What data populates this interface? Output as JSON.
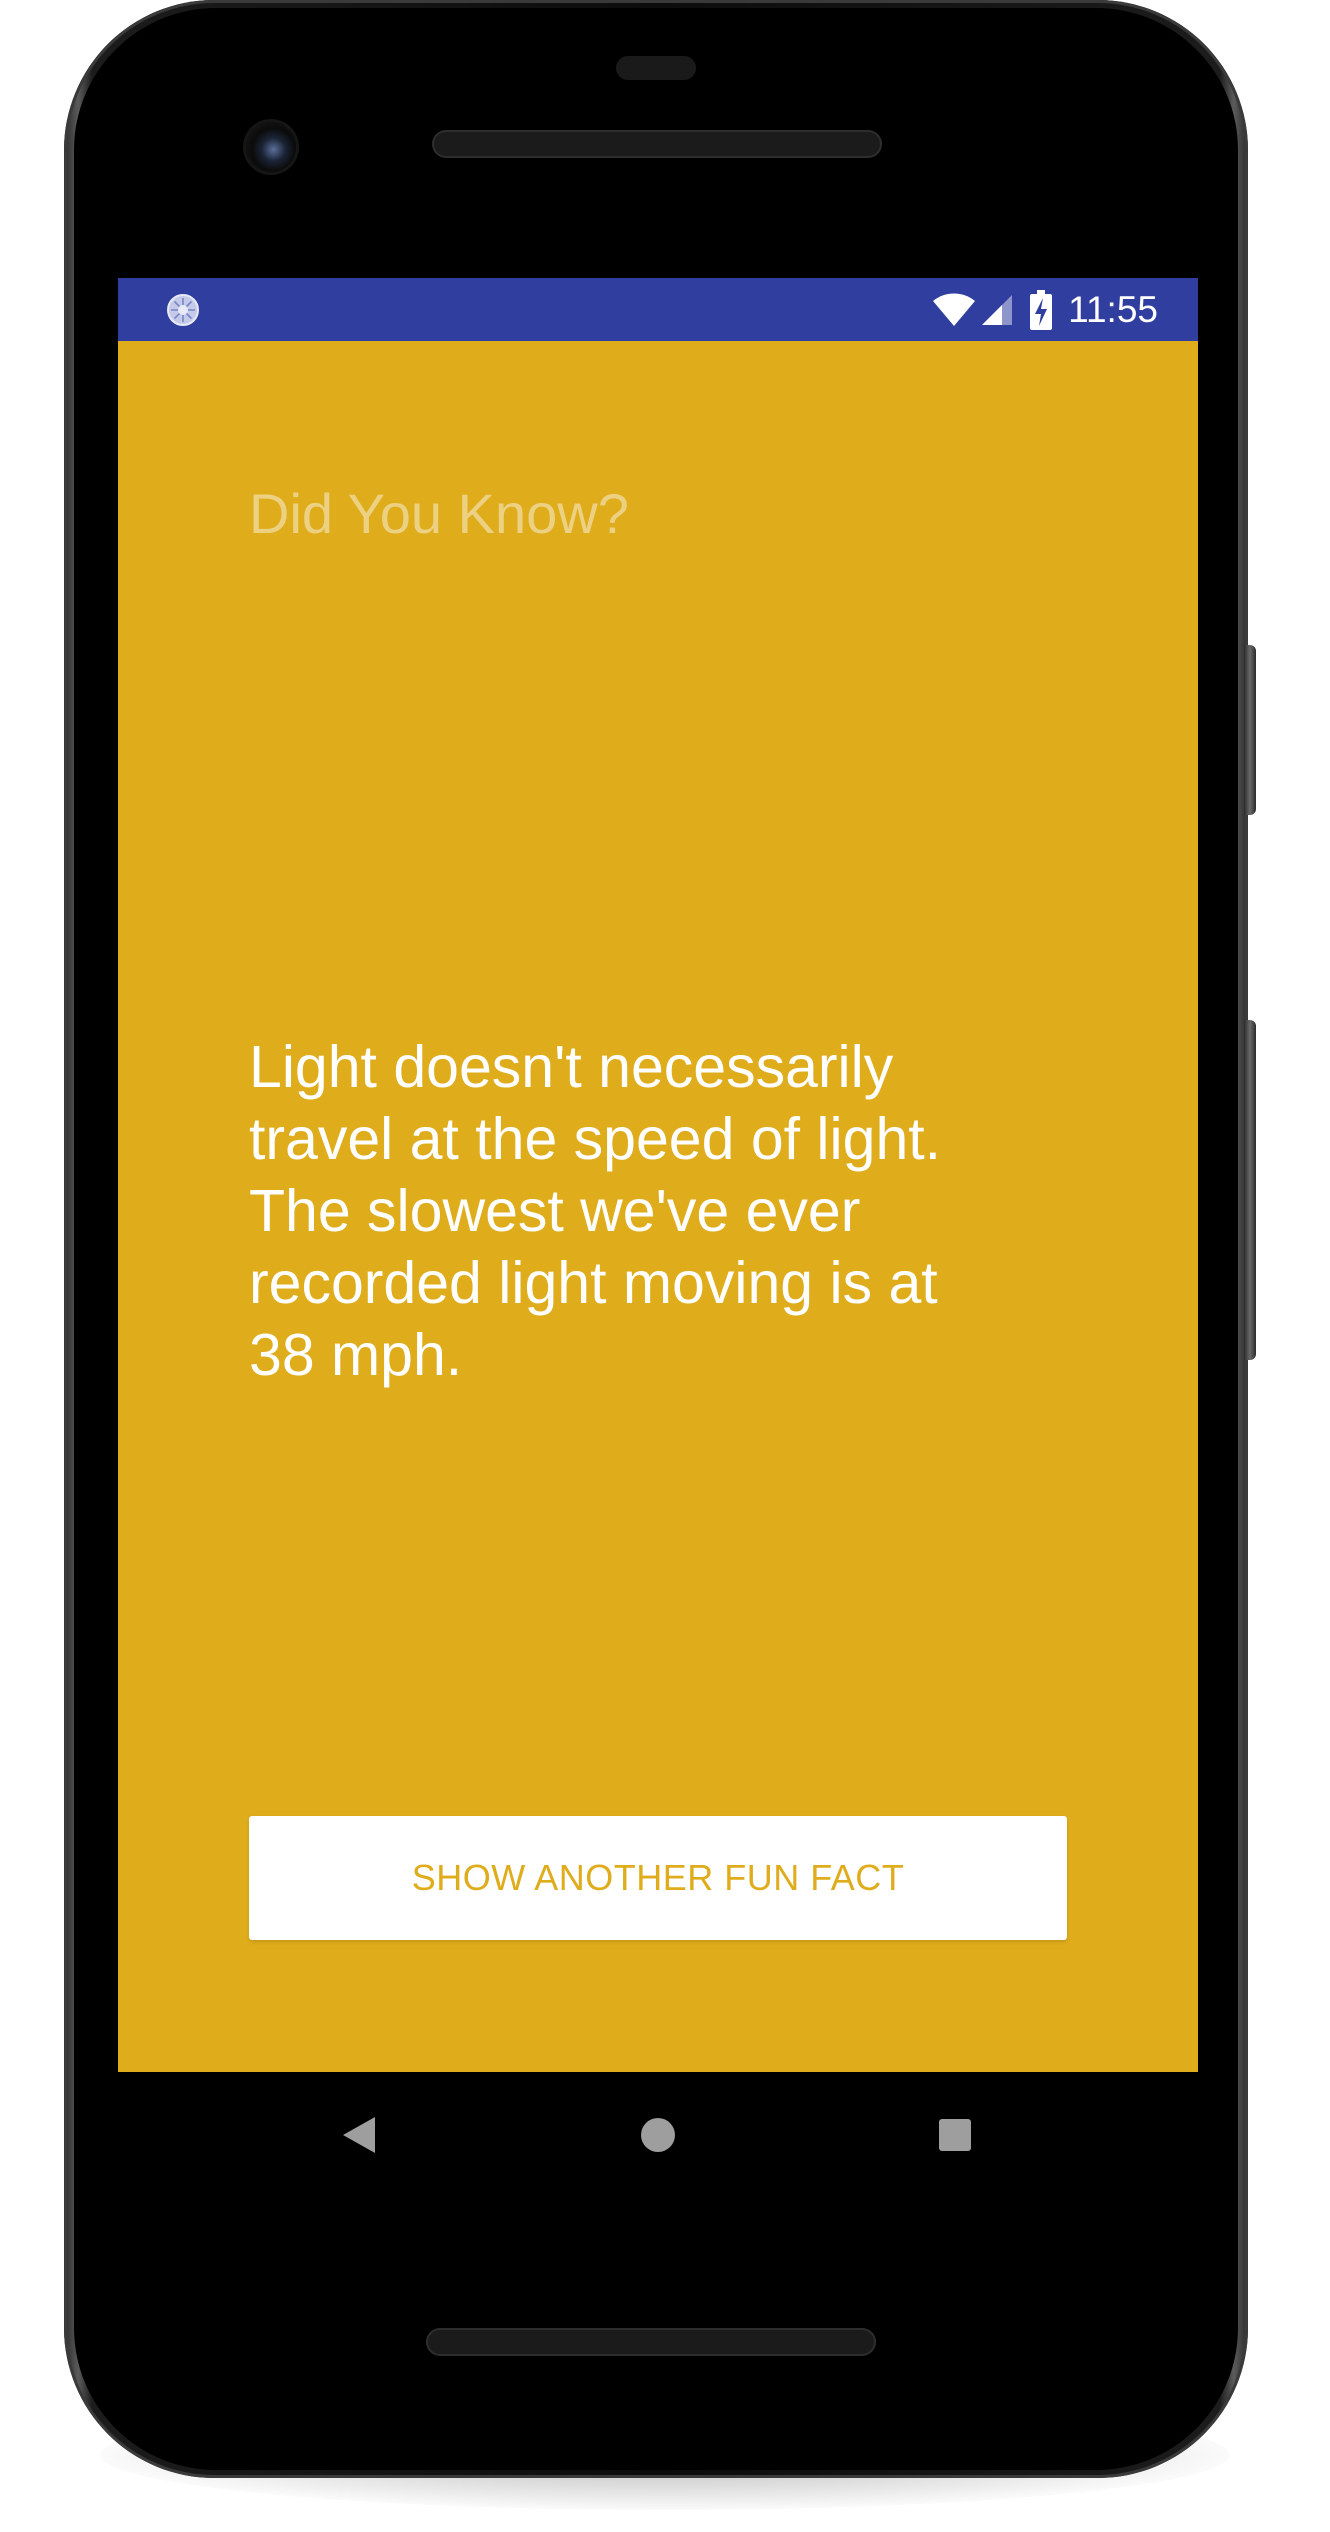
{
  "status_bar": {
    "time": "11:55",
    "background_color": "#303F9F",
    "left_icon": "sync-circle-icon",
    "icons": [
      "wifi-icon",
      "cell-signal-icon",
      "battery-charging-icon"
    ]
  },
  "app": {
    "background_color": "#DFAC1C",
    "headline": "Did You Know?",
    "fact_lines": [
      "Light doesn't necessarily",
      "travel at the speed of light.",
      "The slowest we've ever",
      "recorded light moving is at",
      "38 mph."
    ],
    "button_label": "SHOW ANOTHER FUN FACT"
  },
  "navigation_bar": {
    "buttons": [
      "back-icon",
      "home-icon",
      "recents-icon"
    ]
  }
}
